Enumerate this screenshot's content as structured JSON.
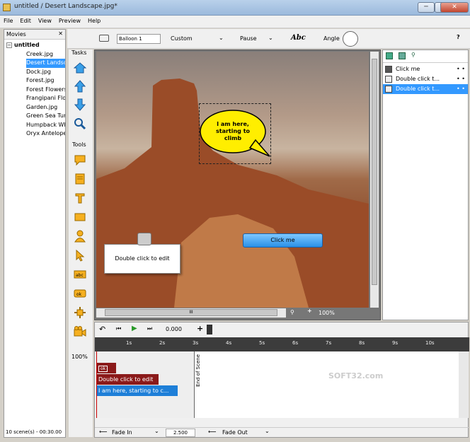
{
  "window": {
    "title": "untitled / Desert Landscape.jpg*",
    "min": "─",
    "max": "□",
    "close": "✕"
  },
  "menu": [
    "File",
    "Edit",
    "View",
    "Preview",
    "Help"
  ],
  "movies": {
    "header": "Movies",
    "root": "untitled",
    "items": [
      "Creek.jpg",
      "Desert Landsc",
      "Dock.jpg",
      "Forest.jpg",
      "Forest Flowers",
      "Frangipani Flo",
      "Garden.jpg",
      "Green Sea Tur",
      "Humpback Wh",
      "Oryx Antelope"
    ],
    "footer": "10 scene(s) - 00:30.00"
  },
  "toolbar": {
    "balloon_name": "Balloon 1",
    "shape": "Custom",
    "pause": "Pause",
    "font": "Abc",
    "angle": "Angle",
    "help": "?"
  },
  "tasks_label": "Tasks",
  "tools_label": "Tools",
  "zoom_left": "100%",
  "canvas": {
    "balloon": "I am here, starting to climb",
    "note": "Double click to edit",
    "button": "Click me",
    "zoom": "100%",
    "hscroll": "III"
  },
  "objects": [
    {
      "label": "Click me"
    },
    {
      "label": "Double click t..."
    },
    {
      "label": "Double click t..."
    }
  ],
  "timeline": {
    "time": "0.000",
    "ticks": [
      "1s",
      "2s",
      "3s",
      "4s",
      "5s",
      "6s",
      "7s",
      "8s",
      "9s",
      "10s"
    ],
    "end_scene": "End of Scene",
    "rows": [
      "ok",
      "Double click to edit",
      "I am here,  starting to  c..."
    ],
    "fade_in": "Fade In",
    "duration": "2.500",
    "fade_out": "Fade Out"
  },
  "watermark": "SOFT32.com",
  "colors": {
    "balloon": "#ffee00",
    "selection": "#3399ff",
    "timeline_dark": "#3c3c3c",
    "row_red": "#8b1a1a",
    "row_blue": "#1e7fd8"
  }
}
